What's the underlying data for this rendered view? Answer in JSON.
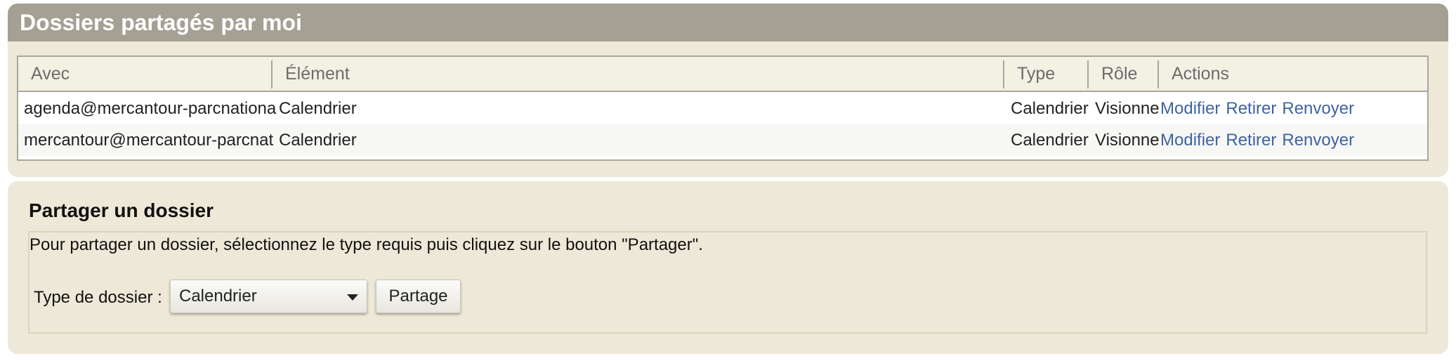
{
  "shared": {
    "title": "Dossiers partagés par moi",
    "columns": {
      "with": "Avec",
      "element": "Élément",
      "type": "Type",
      "role": "Rôle",
      "actions": "Actions"
    },
    "rows": [
      {
        "with": "agenda@mercantour-parcnationa",
        "element": "Calendrier",
        "type": "Calendrier",
        "role": "Visionne",
        "modify": "Modifier",
        "remove": "Retirer",
        "resend": "Renvoyer"
      },
      {
        "with": "mercantour@mercantour-parcnat",
        "element": "Calendrier",
        "type": "Calendrier",
        "role": "Visionne",
        "modify": "Modifier",
        "remove": "Retirer",
        "resend": "Renvoyer"
      }
    ]
  },
  "share": {
    "title": "Partager un dossier",
    "description": "Pour partager un dossier, sélectionnez le type requis puis cliquez sur le bouton \"Partager\".",
    "type_label": "Type de dossier :",
    "type_value": "Calendrier",
    "button": "Partage"
  },
  "colors": {
    "header_bg": "#a5a094",
    "panel_bg": "#ede8d7",
    "link": "#3f63a0"
  }
}
